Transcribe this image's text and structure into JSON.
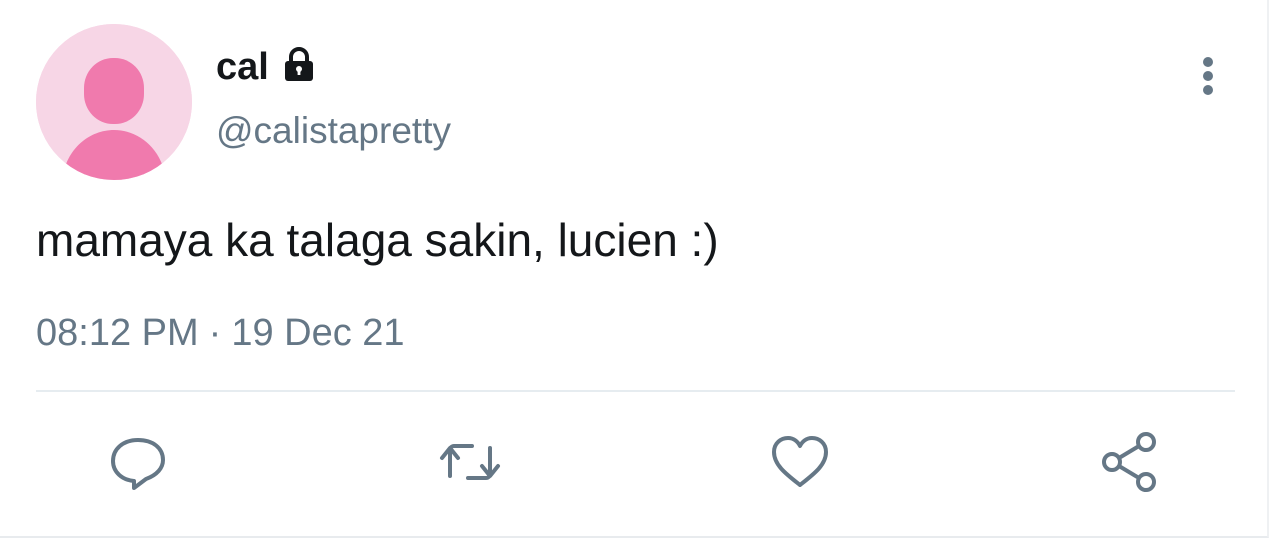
{
  "tweet": {
    "display_name": "cal",
    "handle": "@calistapretty",
    "text": "mamaya ka talaga sakin, lucien :)",
    "time": "08:12 PM",
    "separator": "·",
    "date": "19 Dec 21",
    "protected": true
  },
  "icons": {
    "lock": "lock-icon",
    "more": "more-vertical-icon",
    "reply": "reply-icon",
    "retweet": "retweet-icon",
    "like": "heart-icon",
    "share": "share-icon"
  },
  "colors": {
    "avatar_bg": "#f7d6e6",
    "avatar_fg": "#f07aad",
    "text_primary": "#14171a",
    "text_secondary": "#657786",
    "divider": "#e6ecf0"
  }
}
